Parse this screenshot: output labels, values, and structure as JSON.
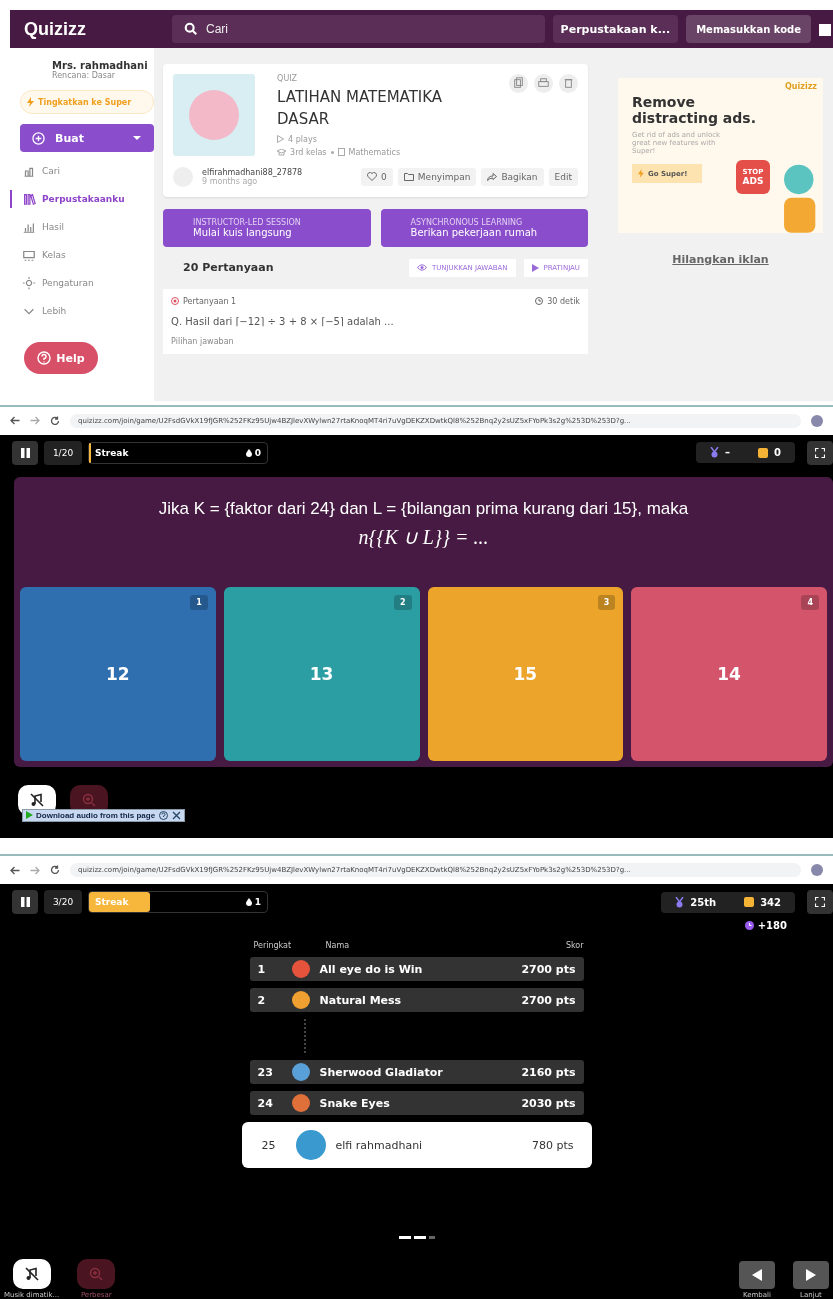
{
  "library": {
    "logo": "Quizizz",
    "search": {
      "placeholder": "Cari"
    },
    "library_dropdown": "Perpustakaan k...",
    "enter_code": "Memasukkan kode",
    "user": {
      "name": "Mrs. rahmadhani",
      "plan": "Rencana: Dasar"
    },
    "upgrade": "Tingkatkan ke Super",
    "create": "Buat",
    "nav": [
      {
        "label": "Cari",
        "selected": false
      },
      {
        "label": "Perpustakaanku",
        "selected": true
      },
      {
        "label": "Hasil",
        "selected": false
      },
      {
        "label": "Kelas",
        "selected": false
      },
      {
        "label": "Pengaturan",
        "selected": false
      },
      {
        "label": "Lebih",
        "selected": false
      }
    ],
    "help": "Help",
    "quiz": {
      "type": "QUIZ",
      "title": "LATIHAN MATEMATIKA DASAR",
      "plays": "4 plays",
      "grade": "3rd kelas",
      "subject": "Mathematics",
      "author": "elfirahmadhani88_27878",
      "time": "9 months ago",
      "likes": "0",
      "save": "Menyimpan",
      "share": "Bagikan",
      "edit": "Edit"
    },
    "sessions": [
      {
        "caption": "INSTRUCTOR-LED SESSION",
        "label": "Mulai kuis langsung"
      },
      {
        "caption": "ASYNCHRONOUS LEARNING",
        "label": "Berikan pekerjaan rumah"
      }
    ],
    "questions": {
      "count": "20 Pertanyaan",
      "show_answers": "TUNJUKKAN JAWABAN",
      "preview": "PRATINJAU",
      "label": "Pertanyaan 1",
      "time": "30 detik",
      "text": "Q. Hasil dari ⌈−12⌉ ÷ 3 + 8 × ⌈−5⌉  adalah ...",
      "choices_label": "Pilihan jawaban"
    },
    "ad": {
      "brand": "Quizizz",
      "headline": "Remove distracting ads.",
      "body": "Get rid of ads and unlock great new features with Super!",
      "badge_top": "STOP",
      "badge": "ADS",
      "cta": "Go Super!"
    },
    "remove_ads": "Hilangkan iklan"
  },
  "game_question": {
    "url": "quizizz.com/join/game/U2FsdGVkX19fJGR%252FKz95Ujw4BZJlevXWylwn27rtaKnoqMT4ri7uVgDEKZXDwtkQl8%252Bnq2y2sUZ5xFYoPk3s2g%253D%253D?g...",
    "progress": "1/20",
    "streak": {
      "label": "Streak",
      "level": 0,
      "count": "0"
    },
    "rank": "–",
    "coins": "0",
    "question": {
      "line1": "Jika K = {faktor dari 24} dan L = {bilangan prima kurang dari 15}, maka",
      "line2": "n{{K ∪ L}} = ..."
    },
    "options": [
      {
        "number": "1",
        "text": "12",
        "color": "#2f6fb0"
      },
      {
        "number": "2",
        "text": "13",
        "color": "#2b9ea3"
      },
      {
        "number": "3",
        "text": "15",
        "color": "#eca42a"
      },
      {
        "number": "4",
        "text": "14",
        "color": "#d4546c"
      }
    ],
    "audio_bar": "Download audio from this page"
  },
  "game_leaderboard": {
    "url": "quizizz.com/join/game/U2FsdGVkX19fJGR%252FKz95Ujw4BZJlevXWylwn27rtaKnoqMT4ri7uVgDEKZXDwtkQl8%252Bnq2y2sUZ5xFYoPk3s2g%253D%253D?g...",
    "progress": "3/20",
    "streak": {
      "label": "Streak",
      "level": 0.34,
      "count": "1"
    },
    "rank": "25th",
    "coins": "342",
    "bonus": "+180",
    "columns": [
      "Peringkat",
      "Nama",
      "Skor"
    ],
    "rows": [
      {
        "rank": "1",
        "name": "All eye do is Win",
        "score": "2700 pts",
        "current": false,
        "color": "#e5533d"
      },
      {
        "rank": "2",
        "name": "Natural Mess",
        "score": "2700 pts",
        "current": false,
        "color": "#f0a030"
      },
      {
        "rank": "23",
        "name": "Sherwood Gladiator",
        "score": "2160 pts",
        "current": false,
        "color": "#5aa0d8"
      },
      {
        "rank": "24",
        "name": "Snake Eyes",
        "score": "2030 pts",
        "current": false,
        "color": "#e0703a"
      },
      {
        "rank": "25",
        "name": "elfi rahmadhani",
        "score": "780 pts",
        "current": true,
        "color": "#3a9ad0"
      }
    ],
    "music_label": "Musik dimatik...",
    "zoom_label": "Perbesar",
    "back": "Kembali",
    "next": "Lanjut"
  }
}
